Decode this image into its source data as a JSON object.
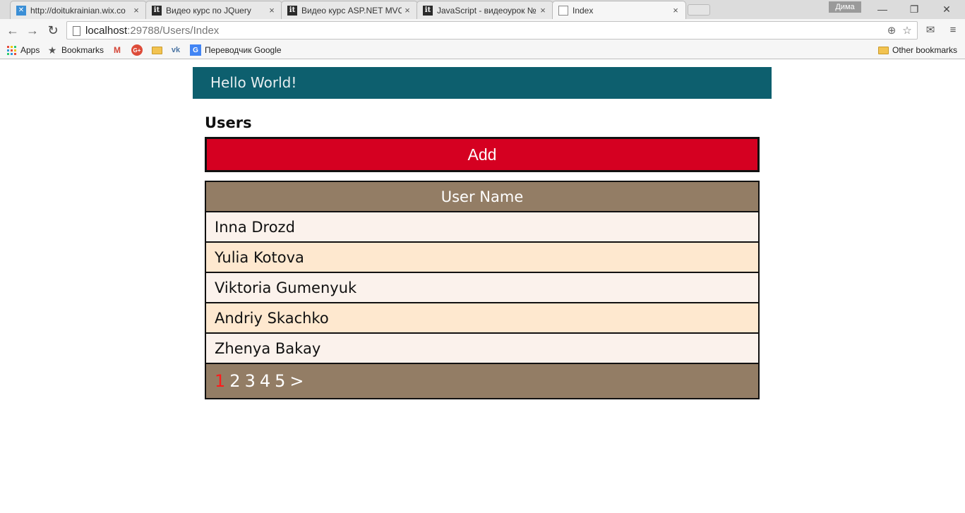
{
  "browser": {
    "tabs": [
      {
        "title": "http://doitukrainian.wix.co",
        "icon": "wix-favicon",
        "active": false
      },
      {
        "title": "Видео курс по JQuery",
        "icon": "itvdn-favicon",
        "active": false
      },
      {
        "title": "Видео курс ASP.NET MVC",
        "icon": "itvdn-favicon",
        "active": false
      },
      {
        "title": "JavaScript - видеоурок №",
        "icon": "itvdn-favicon",
        "active": false
      },
      {
        "title": "Index",
        "icon": "document-favicon",
        "active": true
      }
    ],
    "user_name": "Дима",
    "address": {
      "host": "localhost",
      "path": ":29788/Users/Index"
    },
    "bookmarks": {
      "apps": "Apps",
      "bookmarks": "Bookmarks",
      "translator": "Переводчик Google",
      "other": "Other bookmarks"
    }
  },
  "page": {
    "banner_text": "Hello World!",
    "section_title": "Users",
    "add_button": "Add",
    "table_header": "User Name",
    "users": [
      "Inna Drozd",
      "Yulia Kotova",
      "Viktoria Gumenyuk",
      "Andriy Skachko",
      "Zhenya Bakay"
    ],
    "pager": {
      "pages": [
        "1",
        "2",
        "3",
        "4",
        "5"
      ],
      "current": "1",
      "next": ">"
    }
  },
  "colors": {
    "banner": "#0d5f6e",
    "add_button": "#d50021",
    "table_header": "#937d65",
    "row_odd": "#fbf2ec",
    "row_even": "#fee8cf",
    "current_page": "#ff1a1a"
  }
}
